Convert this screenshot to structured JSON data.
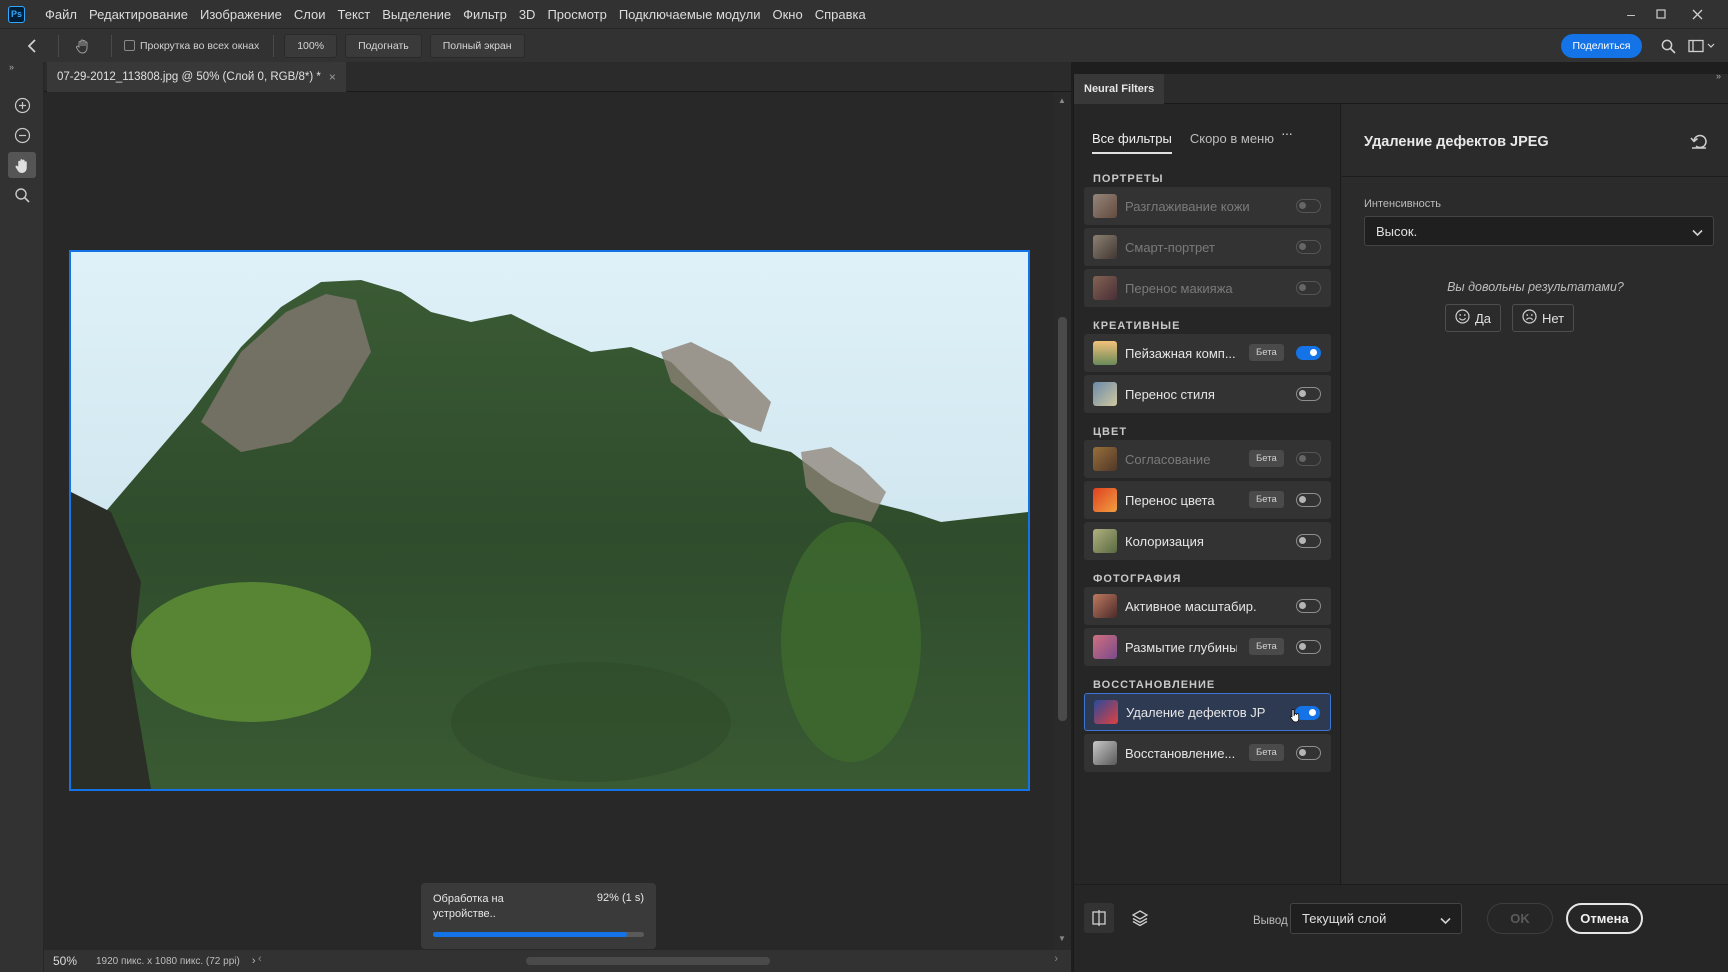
{
  "app": {
    "logo": "Ps"
  },
  "menu": [
    "Файл",
    "Редактирование",
    "Изображение",
    "Слои",
    "Текст",
    "Выделение",
    "Фильтр",
    "3D",
    "Просмотр",
    "Подключаемые модули",
    "Окно",
    "Справка"
  ],
  "options": {
    "scroll_all_label": "Прокрутка во всех окнах",
    "zoom_100": "100%",
    "fit": "Подогнать",
    "full_screen": "Полный экран",
    "share": "Поделиться"
  },
  "document": {
    "tab_title": "07-29-2012_113808.jpg @ 50% (Слой 0, RGB/8*) *",
    "close": "×"
  },
  "status": {
    "zoom": "50%",
    "info": "1920 пикс. x 1080 пикс. (72 ppi)"
  },
  "progress": {
    "label": "Обработка на устройстве..",
    "percent_text": "92% (1 s)",
    "value": 0.92
  },
  "neural_filters": {
    "panel_title": "Neural Filters",
    "tabs": [
      "Все фильтры",
      "Скоро в меню"
    ],
    "more": "···",
    "categories": {
      "portraits": "ПОРТРЕТЫ",
      "creative": "КРЕАТИВНЫЕ",
      "color": "ЦВЕТ",
      "photo": "ФОТОГРАФИЯ",
      "restore": "ВОССТАНОВЛЕНИЕ"
    },
    "filters": [
      {
        "name": "Разглаживание кожи",
        "badge": "",
        "on": false,
        "enabled": false
      },
      {
        "name": "Смарт-портрет",
        "badge": "",
        "on": false,
        "enabled": false
      },
      {
        "name": "Перенос макияжа",
        "badge": "",
        "on": false,
        "enabled": false
      },
      {
        "name": "Пейзажная комп...",
        "badge": "Бета",
        "on": true,
        "enabled": true
      },
      {
        "name": "Перенос стиля",
        "badge": "",
        "on": false,
        "enabled": true
      },
      {
        "name": "Согласование",
        "badge": "Бета",
        "on": false,
        "enabled": false
      },
      {
        "name": "Перенос цвета",
        "badge": "Бета",
        "on": false,
        "enabled": true
      },
      {
        "name": "Колоризация",
        "badge": "",
        "on": false,
        "enabled": true
      },
      {
        "name": "Активное масштабир.",
        "badge": "",
        "on": false,
        "enabled": true
      },
      {
        "name": "Размытие глубины",
        "badge": "Бета",
        "on": false,
        "enabled": true
      },
      {
        "name": "Удаление дефектов JPEG",
        "badge": "",
        "on": true,
        "enabled": true
      },
      {
        "name": "Восстановление...",
        "badge": "Бета",
        "on": false,
        "enabled": true
      }
    ],
    "detail": {
      "title": "Удаление дефектов JPEG",
      "intensity_label": "Интенсивность",
      "intensity_value": "Высок.",
      "question": "Вы довольны результатами?",
      "yes": "Да",
      "no": "Нет"
    },
    "bottom": {
      "output_label": "Вывод",
      "output_value": "Текущий слой",
      "ok": "OK",
      "cancel": "Отмена"
    }
  },
  "colors": {
    "accent": "#1473e6",
    "panel": "#282828"
  }
}
